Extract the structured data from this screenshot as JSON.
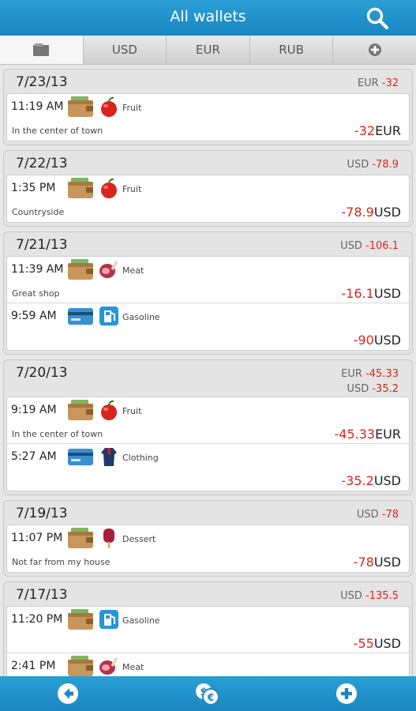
{
  "header": {
    "title": "All wallets",
    "search_icon": "search-icon"
  },
  "tabs": [
    {
      "icon": "wallet-icon",
      "label": ""
    },
    {
      "label": "USD"
    },
    {
      "label": "EUR"
    },
    {
      "label": "RUB"
    },
    {
      "icon": "add-circle-icon",
      "label": ""
    }
  ],
  "days": [
    {
      "date": "7/23/13",
      "totals": [
        {
          "cur": "EUR",
          "val": "-32"
        }
      ],
      "transactions": [
        {
          "time": "11:19 AM",
          "wallet": "cash",
          "category": "Fruit",
          "note": "In the center of town",
          "amount": "-32",
          "currency": "EUR"
        }
      ]
    },
    {
      "date": "7/22/13",
      "totals": [
        {
          "cur": "USD",
          "val": "-78.9"
        }
      ],
      "transactions": [
        {
          "time": "1:35 PM",
          "wallet": "cash",
          "category": "Fruit",
          "note": "Countryside",
          "amount": "-78.9",
          "currency": "USD"
        }
      ]
    },
    {
      "date": "7/21/13",
      "totals": [
        {
          "cur": "USD",
          "val": "-106.1"
        }
      ],
      "transactions": [
        {
          "time": "11:39 AM",
          "wallet": "cash",
          "category": "Meat",
          "note": "Great shop",
          "amount": "-16.1",
          "currency": "USD"
        },
        {
          "time": "9:59 AM",
          "wallet": "card",
          "category": "Gasoline",
          "note": "",
          "amount": "-90",
          "currency": "USD"
        }
      ]
    },
    {
      "date": "7/20/13",
      "totals": [
        {
          "cur": "EUR",
          "val": "-45.33"
        },
        {
          "cur": "USD",
          "val": "-35.2"
        }
      ],
      "transactions": [
        {
          "time": "9:19 AM",
          "wallet": "cash",
          "category": "Fruit",
          "note": "In the center of town",
          "amount": "-45.33",
          "currency": "EUR"
        },
        {
          "time": "5:27 AM",
          "wallet": "card",
          "category": "Clothing",
          "note": "",
          "amount": "-35.2",
          "currency": "USD"
        }
      ]
    },
    {
      "date": "7/19/13",
      "totals": [
        {
          "cur": "USD",
          "val": "-78"
        }
      ],
      "transactions": [
        {
          "time": "11:07 PM",
          "wallet": "cash",
          "category": "Dessert",
          "note": "Not far from my house",
          "amount": "-78",
          "currency": "USD"
        }
      ]
    },
    {
      "date": "7/17/13",
      "totals": [
        {
          "cur": "USD",
          "val": "-135.5"
        }
      ],
      "transactions": [
        {
          "time": "11:20 PM",
          "wallet": "cash",
          "category": "Gasoline",
          "note": "",
          "amount": "-55",
          "currency": "USD"
        },
        {
          "time": "2:41 PM",
          "wallet": "cash",
          "category": "Meat",
          "note": "",
          "amount": "",
          "currency": ""
        }
      ]
    }
  ],
  "bottom": {
    "back_icon": "back-arrow-icon",
    "transfer_icon": "currency-exchange-icon",
    "add_icon": "add-circle-icon"
  },
  "colors": {
    "accent": "#1a86c1",
    "negative": "#d9261c"
  }
}
